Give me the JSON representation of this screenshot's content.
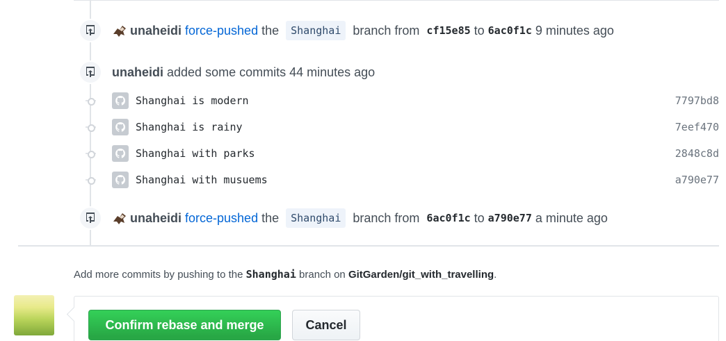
{
  "events": [
    {
      "actor": "unaheidi",
      "action": "force-pushed",
      "the": "the",
      "branch": "Shanghai",
      "branch_word": "branch from",
      "from_sha": "cf15e85",
      "to_word": "to",
      "to_sha": "6ac0f1c",
      "time": "9 minutes ago"
    },
    {
      "actor": "unaheidi",
      "action": "added some commits 44 minutes ago"
    },
    {
      "actor": "unaheidi",
      "action": "force-pushed",
      "the": "the",
      "branch": "Shanghai",
      "branch_word": "branch from",
      "from_sha": "6ac0f1c",
      "to_word": "to",
      "to_sha": "a790e77",
      "time": "a minute ago"
    }
  ],
  "commits": [
    {
      "message": "Shanghai is modern",
      "sha": "7797bd8"
    },
    {
      "message": "Shanghai is rainy",
      "sha": "7eef470"
    },
    {
      "message": "Shanghai with parks",
      "sha": "2848c8d"
    },
    {
      "message": "Shanghai with musuems",
      "sha": "a790e77"
    }
  ],
  "hint": {
    "prefix": "Add more commits by pushing to the",
    "branch": "Shanghai",
    "middle": "branch on",
    "repo": "GitGarden/git_with_travelling",
    "suffix": "."
  },
  "merge": {
    "confirm_label": "Confirm rebase and merge",
    "cancel_label": "Cancel"
  },
  "colors": {
    "link": "#0366d6",
    "confirm_green": "#28a745"
  },
  "icons": [
    "repo-push-icon",
    "github-octocat-icon",
    "commit-node-icon"
  ]
}
